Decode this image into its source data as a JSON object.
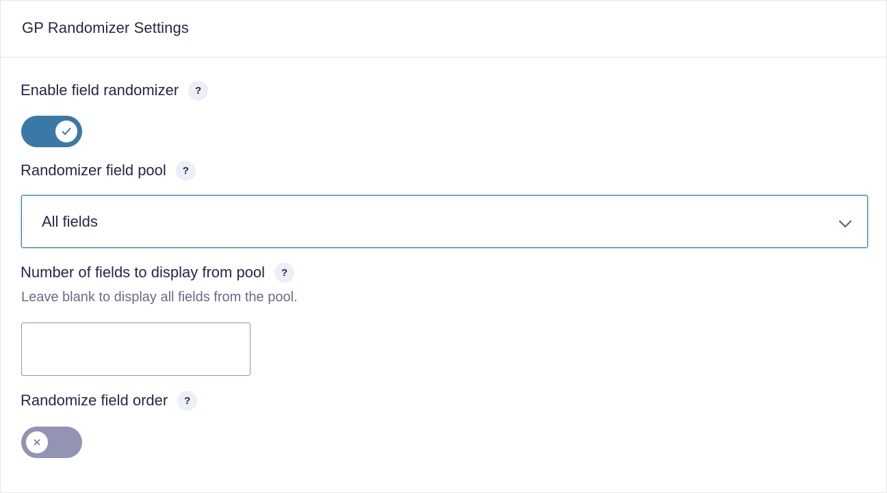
{
  "panel": {
    "title": "GP Randomizer Settings"
  },
  "settings": {
    "enable_randomizer": {
      "label": "Enable field randomizer",
      "help": "?",
      "enabled": true
    },
    "field_pool": {
      "label": "Randomizer field pool",
      "help": "?",
      "selected": "All fields"
    },
    "display_count": {
      "label": "Number of fields to display from pool",
      "help": "?",
      "description": "Leave blank to display all fields from the pool.",
      "value": "",
      "placeholder": ""
    },
    "randomize_order": {
      "label": "Randomize field order",
      "help": "?",
      "enabled": false
    }
  },
  "icons": {
    "toggle_on": "checkmark-icon",
    "toggle_off": "x-icon",
    "select": "chevron-down-icon"
  },
  "colors": {
    "toggle_on": "#3a79a6",
    "toggle_off": "#9394b4",
    "select_border": "#3e7cc4",
    "text": "#242748",
    "muted_text": "#686a8a",
    "help_badge": "#eceef8"
  }
}
